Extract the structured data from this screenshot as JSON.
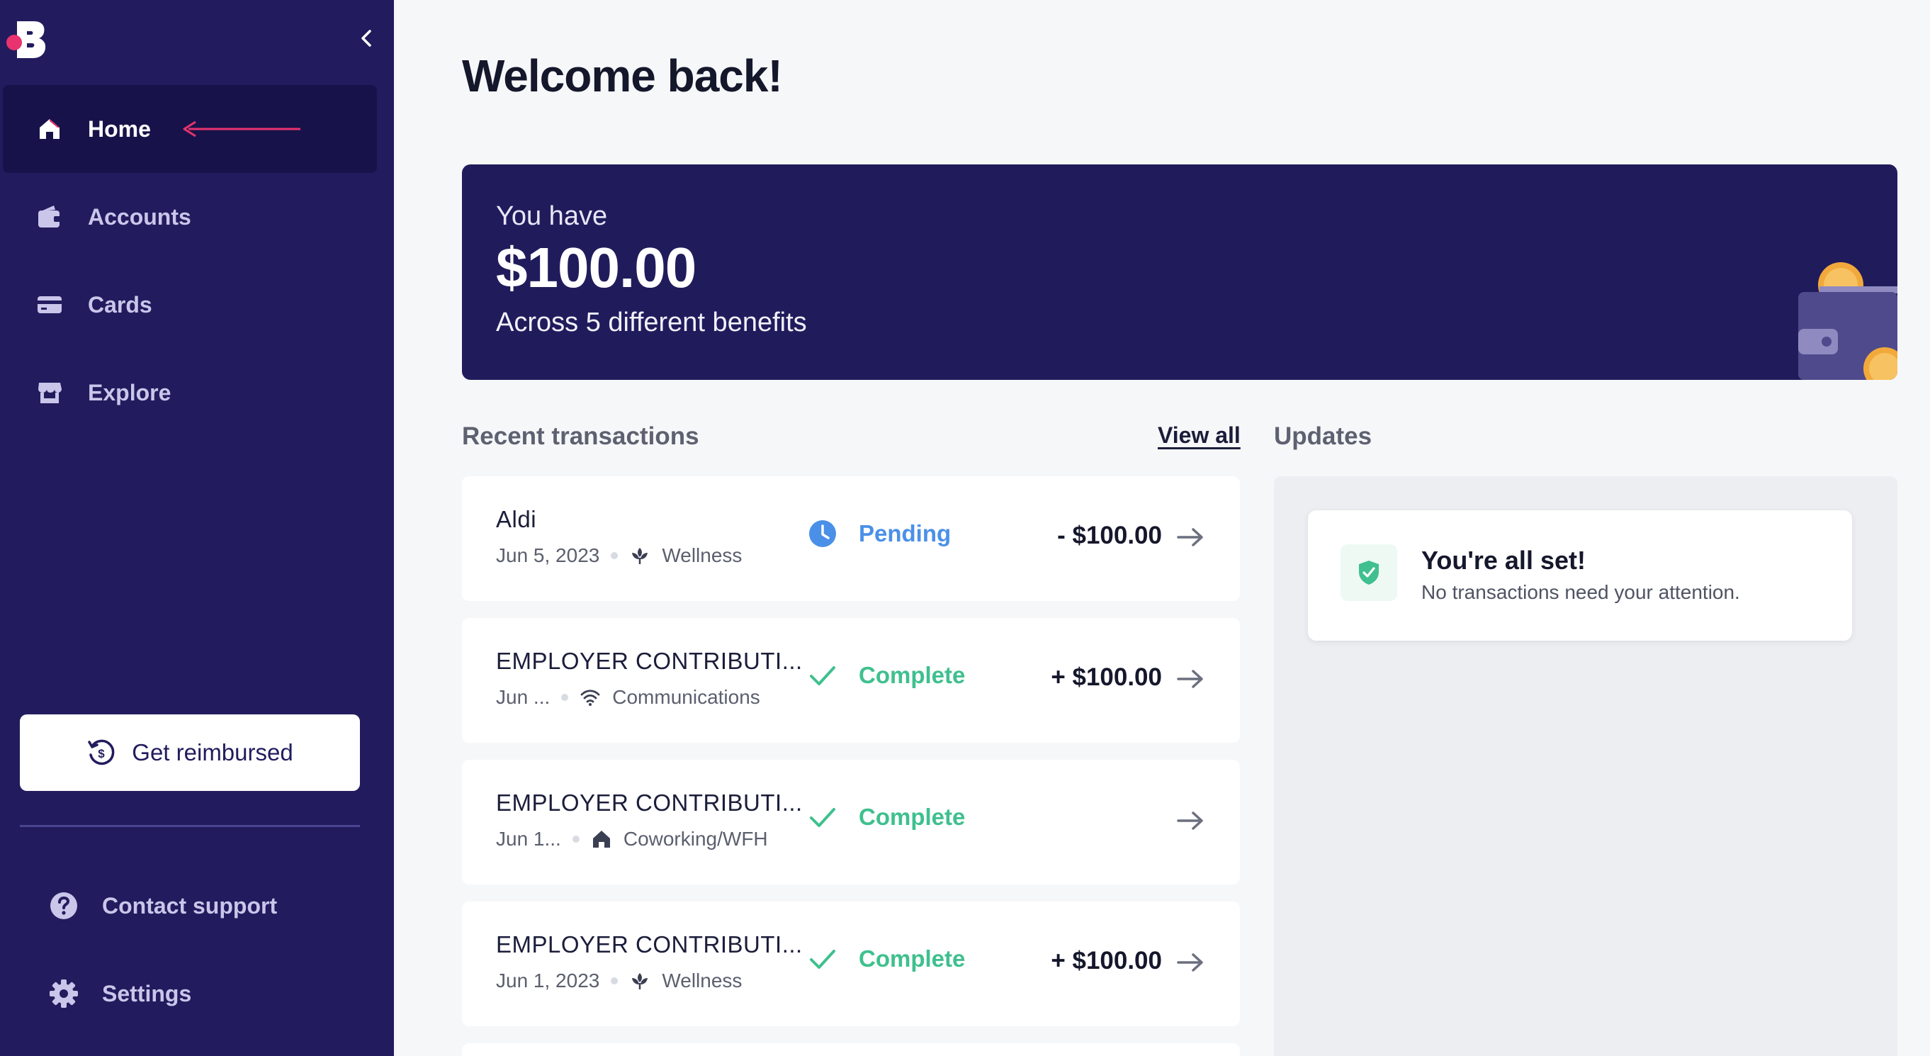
{
  "sidebar": {
    "collapse_icon": "chevron-left-icon",
    "items": [
      {
        "label": "Home",
        "icon": "home-icon",
        "active": true
      },
      {
        "label": "Accounts",
        "icon": "wallet-icon"
      },
      {
        "label": "Cards",
        "icon": "card-icon"
      },
      {
        "label": "Explore",
        "icon": "store-icon"
      }
    ],
    "reimburse_label": "Get reimbursed",
    "footer": [
      {
        "label": "Contact support",
        "icon": "help-icon"
      },
      {
        "label": "Settings",
        "icon": "gear-icon"
      }
    ]
  },
  "page": {
    "title": "Welcome back!"
  },
  "balance": {
    "label": "You have",
    "amount": "$100.00",
    "subtitle": "Across 5 different benefits"
  },
  "transactions": {
    "heading": "Recent transactions",
    "view_all": "View all",
    "items": [
      {
        "name": "Aldi",
        "date": "Jun 5, 2023",
        "category": "Wellness",
        "category_icon": "leaf-icon",
        "status": "Pending",
        "amount": "- $100.00"
      },
      {
        "name": "EMPLOYER CONTRIBUTI...",
        "date": "Jun ...",
        "category": "Communications",
        "category_icon": "wifi-icon",
        "status": "Complete",
        "amount": "+ $100.00"
      },
      {
        "name": "EMPLOYER CONTRIBUTI...",
        "date": "Jun 1...",
        "category": "Coworking/WFH",
        "category_icon": "house-icon",
        "status": "Complete",
        "amount": ""
      },
      {
        "name": "EMPLOYER CONTRIBUTI...",
        "date": "Jun 1, 2023",
        "category": "Wellness",
        "category_icon": "leaf-icon",
        "status": "Complete",
        "amount": "+ $100.00"
      }
    ]
  },
  "updates": {
    "heading": "Updates",
    "card_title": "You're all set!",
    "card_subtitle": "No transactions need your attention."
  },
  "colors": {
    "sidebar_bg": "#221c5e",
    "active_nav_bg": "#17134a",
    "brand_pink": "#e8336e",
    "pending": "#4a90e8",
    "complete": "#3fc08e"
  }
}
